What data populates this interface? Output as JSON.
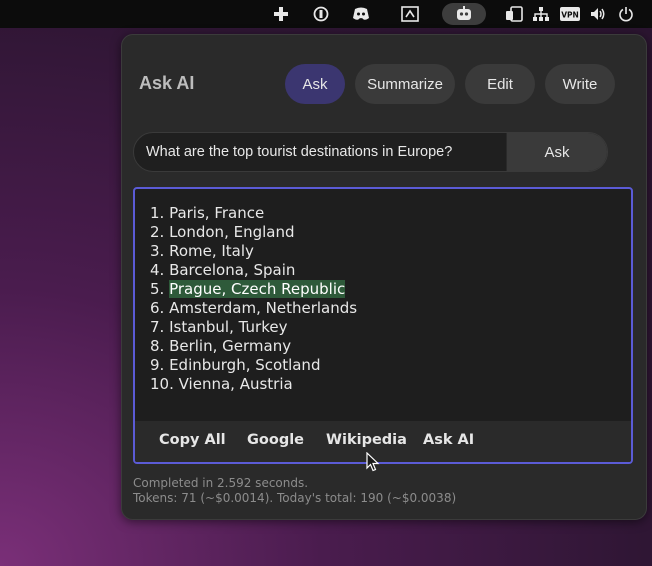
{
  "topbar": {
    "icons": [
      {
        "name": "extensions-icon",
        "glyph": "✚"
      },
      {
        "name": "caffeine-icon",
        "glyph": "◐"
      },
      {
        "name": "discord-icon",
        "glyph": "◉"
      },
      {
        "name": "screenshot-icon",
        "glyph": "⧉"
      },
      {
        "name": "ai-assistant-icon",
        "glyph": "⚉"
      },
      {
        "name": "cast-icon",
        "glyph": "▭"
      },
      {
        "name": "network-wired-icon",
        "glyph": "⊞"
      },
      {
        "name": "vpn-icon",
        "glyph": "VPN"
      },
      {
        "name": "volume-icon",
        "glyph": "🔊"
      },
      {
        "name": "power-icon",
        "glyph": "⏻"
      }
    ]
  },
  "panel": {
    "title": "Ask AI",
    "modes": [
      "Ask",
      "Summarize",
      "Edit",
      "Write"
    ],
    "active_mode": "Ask",
    "query_value": "What are the top tourist destinations in Europe?",
    "submit_label": "Ask",
    "results": [
      "1. Paris, France",
      "2. London, England",
      "3. Rome, Italy",
      "4. Barcelona, Spain",
      "5. ",
      "6. Amsterdam, Netherlands",
      "7. Istanbul, Turkey",
      "8. Berlin, Germany",
      "9. Edinburgh, Scotland",
      "10. Vienna, Austria"
    ],
    "highlighted_text": "Prague, Czech Republic",
    "actions": [
      "Copy All",
      "Google",
      "Wikipedia",
      "Ask AI"
    ],
    "status_line1": "Completed in 2.592 seconds.",
    "status_line2": "Tokens: 71 (~$0.0014). Today's total: 190 (~$0.0038)"
  },
  "colors": {
    "accent_active": "#3b3670",
    "focus_border": "#5b5bd6",
    "highlight": "#2e5a3a"
  }
}
